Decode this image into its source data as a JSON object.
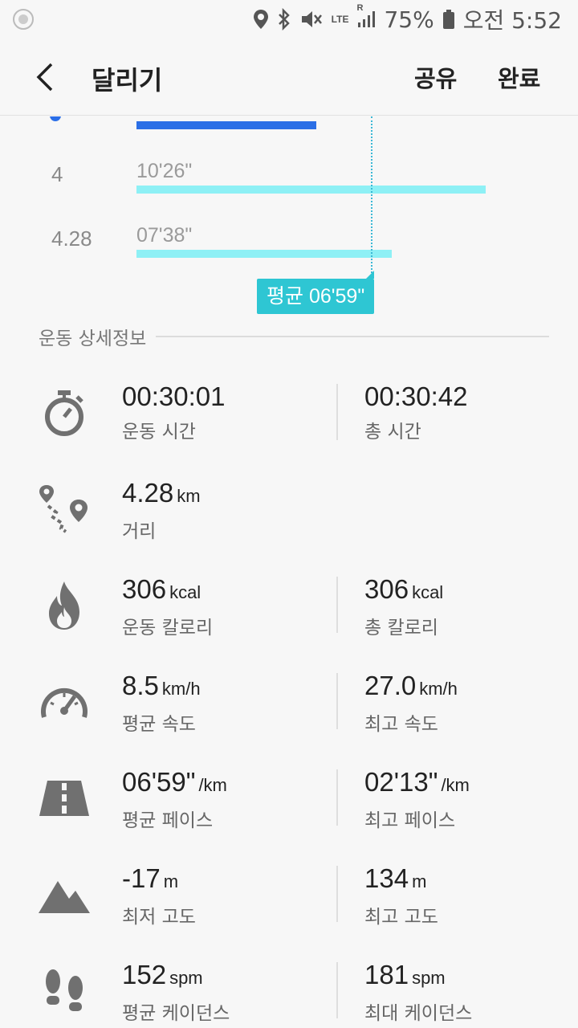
{
  "status_bar": {
    "network": "LTE",
    "network_r": "R",
    "battery": "75%",
    "time": "오전 5:52"
  },
  "app_bar": {
    "title": "달리기",
    "share_label": "공유",
    "done_label": "완료"
  },
  "pace_chart": {
    "rows": [
      {
        "km": "4",
        "pace": "10'26\"",
        "fill": 0.82
      },
      {
        "km": "4.28",
        "pace": "07'38\"",
        "fill": 0.6
      }
    ],
    "average_badge": "평균 06'59\""
  },
  "section": {
    "title": "운동 상세정보"
  },
  "stats": {
    "time": {
      "left_value": "00:30:01",
      "left_label": "운동 시간",
      "right_value": "00:30:42",
      "right_label": "총 시간"
    },
    "distance": {
      "left_value": "4.28",
      "left_unit": "km",
      "left_label": "거리"
    },
    "calories": {
      "left_value": "306",
      "left_unit": "kcal",
      "left_label": "운동 칼로리",
      "right_value": "306",
      "right_unit": "kcal",
      "right_label": "총 칼로리"
    },
    "speed": {
      "left_value": "8.5",
      "left_unit": "km/h",
      "left_label": "평균 속도",
      "right_value": "27.0",
      "right_unit": "km/h",
      "right_label": "최고 속도"
    },
    "pace": {
      "left_value": "06'59\"",
      "left_unit": "/km",
      "left_label": "평균 페이스",
      "right_value": "02'13\"",
      "right_unit": "/km",
      "right_label": "최고 페이스"
    },
    "altitude": {
      "left_value": "-17",
      "left_unit": "m",
      "left_label": "최저 고도",
      "right_value": "134",
      "right_unit": "m",
      "right_label": "최고 고도"
    },
    "cadence": {
      "left_value": "152",
      "left_unit": "spm",
      "left_label": "평균 케이던스",
      "right_value": "181",
      "right_unit": "spm",
      "right_label": "최대 케이던스"
    }
  },
  "colors": {
    "accent_blue": "#2b6fe6",
    "pace_bar": "#8ef0f5",
    "badge": "#2ec6d3",
    "icon_gray": "#707070"
  }
}
